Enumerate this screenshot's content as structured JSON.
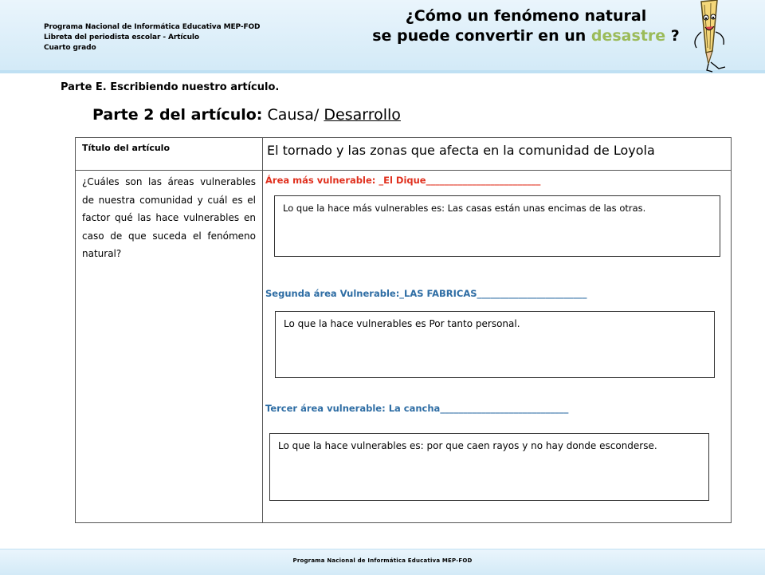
{
  "header": {
    "program_line": "Programa Nacional de Informática Educativa MEP-FOD",
    "notebook_line": "Libreta del periodista escolar -  Artículo",
    "grade_line": "Cuarto grado",
    "title_line1": "¿Cómo un fenómeno natural",
    "title_line2_start": "se puede convertir en un",
    "title_line2_highlight": "desastre",
    "title_line2_end": "?",
    "highlight_color": "#9bbb59"
  },
  "section": {
    "heading": "Parte E. Escribiendo nuestro artículo.",
    "sub_bold": "Parte 2 del artículo:",
    "sub_plain": "Causa/",
    "sub_underlined": "Desarrollo"
  },
  "table": {
    "title_label": "Título del artículo",
    "title_value": "El tornado y las zonas que afecta en la comunidad de Loyola",
    "question": "¿Cuáles son las áreas vulnerables de nuestra comunidad y cuál es el factor qué las hace vulnerables en caso de que suceda el fenómeno natural?",
    "area1_label": "Área más vulnerable: _El Dique_________________________",
    "area1_reason": "Lo que la hace más vulnerables es: Las casas están unas encimas de las otras.",
    "area2_label": "Segunda área Vulnerable:_LAS FABRICAS________________________",
    "area2_reason": "Lo que la hace vulnerables es Por tanto personal.",
    "area3_label": "Tercer área vulnerable: La cancha____________________________",
    "area3_reason": "Lo que la hace vulnerables es: por que caen rayos y no hay donde esconderse.",
    "area1_color": "#e0301e",
    "area_color": "#2e6da4"
  },
  "footer": {
    "text": "Programa  Nacional de Informática  Educativa MEP-FOD"
  }
}
